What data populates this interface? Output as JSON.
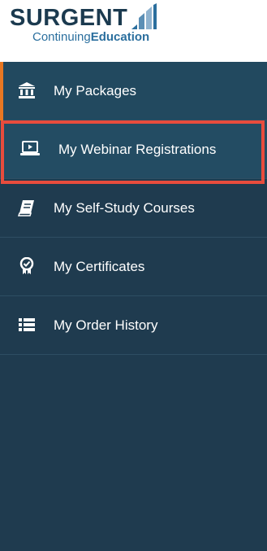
{
  "brand": {
    "name": "SURGENT",
    "sub_regular": "Continuing",
    "sub_bold": "Education"
  },
  "nav": {
    "items": [
      {
        "label": "My Packages",
        "icon": "bank-icon"
      },
      {
        "label": "My Webinar Registrations",
        "icon": "laptop-play-icon"
      },
      {
        "label": "My Self-Study Courses",
        "icon": "book-icon"
      },
      {
        "label": "My Certificates",
        "icon": "award-badge-icon"
      },
      {
        "label": "My Order History",
        "icon": "list-icon"
      }
    ]
  },
  "colors": {
    "sidebar_bg": "#1f3b4f",
    "accent": "#e87722",
    "highlight_border": "#e84c3d",
    "brand_dark": "#1b3a4f",
    "brand_blue": "#2b6f9e"
  }
}
